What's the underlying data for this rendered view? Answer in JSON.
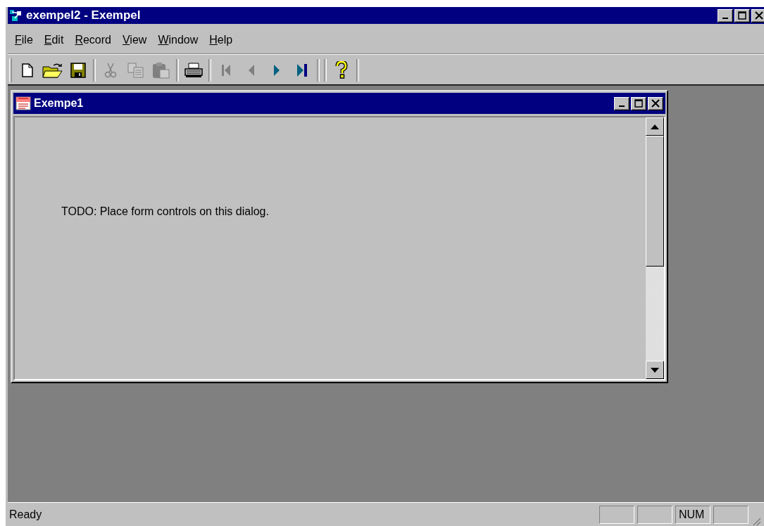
{
  "window": {
    "title": "exempel2 - Exempel"
  },
  "menu": [
    {
      "label": "File"
    },
    {
      "label": "Edit"
    },
    {
      "label": "Record"
    },
    {
      "label": "View"
    },
    {
      "label": "Window"
    },
    {
      "label": "Help"
    }
  ],
  "toolbar": [
    {
      "kind": "new",
      "disabled": false
    },
    {
      "kind": "open",
      "disabled": false
    },
    {
      "kind": "save",
      "disabled": false
    },
    {
      "kind": "separator"
    },
    {
      "kind": "cut",
      "disabled": true
    },
    {
      "kind": "copy",
      "disabled": true
    },
    {
      "kind": "paste",
      "disabled": true
    },
    {
      "kind": "separator"
    },
    {
      "kind": "print",
      "disabled": false
    },
    {
      "kind": "separator"
    },
    {
      "kind": "first",
      "disabled": true
    },
    {
      "kind": "prev",
      "disabled": true
    },
    {
      "kind": "next",
      "disabled": false
    },
    {
      "kind": "last",
      "disabled": false
    },
    {
      "kind": "separator"
    },
    {
      "kind": "separator"
    },
    {
      "kind": "help",
      "disabled": false
    }
  ],
  "child_window": {
    "title": "Exempe1",
    "body_text": "TODO: Place form controls on this dialog."
  },
  "status_bar": {
    "message": "Ready",
    "indicators": [
      "NUM"
    ]
  }
}
